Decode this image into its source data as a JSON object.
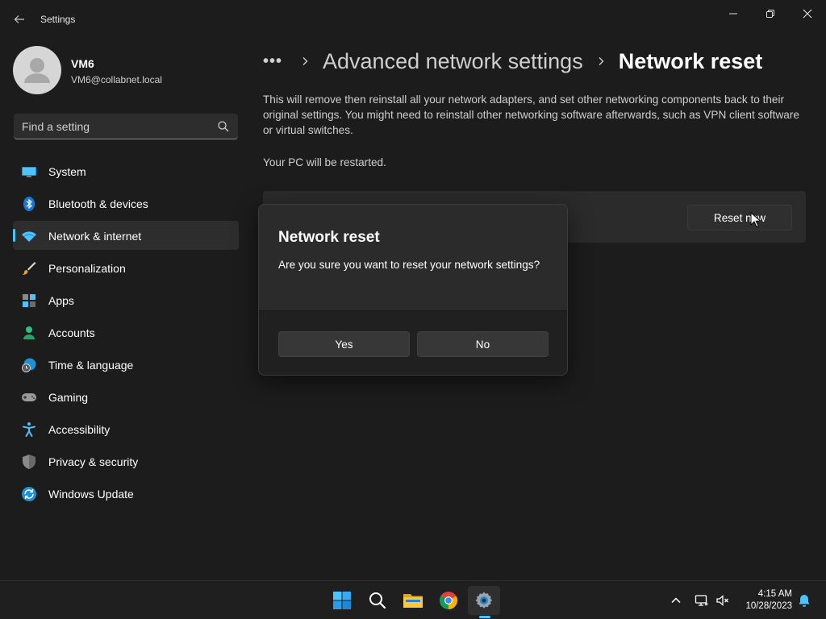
{
  "window": {
    "title": "Settings"
  },
  "user": {
    "name": "VM6",
    "email": "VM6@collabnet.local"
  },
  "search": {
    "placeholder": "Find a setting"
  },
  "sidebar": {
    "items": [
      {
        "label": "System",
        "icon": "monitor-icon"
      },
      {
        "label": "Bluetooth & devices",
        "icon": "bluetooth-icon"
      },
      {
        "label": "Network & internet",
        "icon": "wifi-icon",
        "selected": true
      },
      {
        "label": "Personalization",
        "icon": "brush-icon"
      },
      {
        "label": "Apps",
        "icon": "apps-icon"
      },
      {
        "label": "Accounts",
        "icon": "person-icon"
      },
      {
        "label": "Time & language",
        "icon": "clock-globe-icon"
      },
      {
        "label": "Gaming",
        "icon": "gamepad-icon"
      },
      {
        "label": "Accessibility",
        "icon": "accessibility-icon"
      },
      {
        "label": "Privacy & security",
        "icon": "shield-icon"
      },
      {
        "label": "Windows Update",
        "icon": "update-icon"
      }
    ]
  },
  "breadcrumb": {
    "more": "•••",
    "parent": "Advanced network settings",
    "current": "Network reset"
  },
  "main": {
    "description": "This will remove then reinstall all your network adapters, and set other networking components back to their original settings. You might need to reinstall other networking software afterwards, such as VPN client software or virtual switches.",
    "restart_note": "Your PC will be restarted.",
    "reset_button": "Reset now"
  },
  "dialog": {
    "title": "Network reset",
    "message": "Are you sure you want to reset your network settings?",
    "yes": "Yes",
    "no": "No"
  },
  "taskbar": {
    "time": "4:15 AM",
    "date": "10/28/2023"
  },
  "colors": {
    "accent": "#4cc2ff",
    "background": "#1c1c1c",
    "card": "#2b2b2b"
  }
}
